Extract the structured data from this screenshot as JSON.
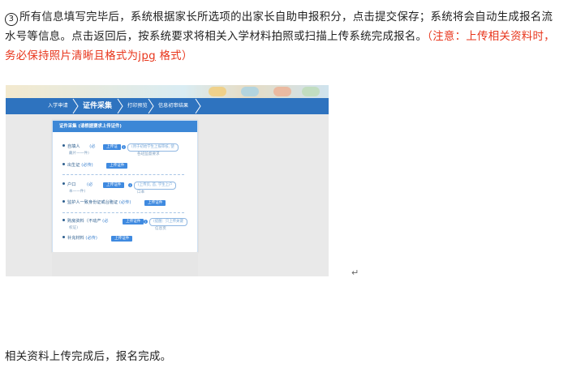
{
  "paragraph": {
    "step_marker": "3",
    "text_line1": "所有信息填写完毕后，系统根据家长所选项的出家长自助申报积分，点击提交保存；系统将会自动生成报名流",
    "text_line2": "水号等信息。点击返回后，按系统要求将相关入学材料拍照或扫描上传系统完成报名。",
    "note_part1": "（注意：上传相关资料时，",
    "note_part2": "务必保持照片清晰且格式为",
    "note_format": "jpg",
    "note_part3": " 格式）"
  },
  "screenshot": {
    "steps": [
      "入学申请",
      "证件采集",
      "打印预览",
      "信息初审结果"
    ],
    "panel_title": "证件采集 (请根据要求上传证件)",
    "items": [
      {
        "label": "自填人",
        "sub": "戴片一一件)",
        "required": "(必",
        "button": "上传证",
        "hint": "(用于初始学生上报审核, 使",
        "hint_sub": "各班监督要求"
      },
      {
        "label": "出生证",
        "required": "(必传)",
        "button": "上传证件"
      },
      {
        "label": "户口",
        "sub": "本一一件)",
        "required": "(必",
        "button": "上传证件",
        "hint": "(上传页, 首, 学生上户",
        "hint_sub": "口本"
      },
      {
        "label": "监护人一致身份证或台胞证",
        "required": "(必传)",
        "button": "上传证件"
      },
      {
        "label": "购房资料（不动产",
        "sub": "权证)",
        "required": "(必",
        "button": "上传证件",
        "hint": "(提醒：只上传关键",
        "hint_sub": "信息页"
      },
      {
        "label": "补充材料",
        "required": "(必传)",
        "button": "上传证件"
      }
    ]
  },
  "return_mark": "↵",
  "final_text": "相关资料上传完成后，报名完成。"
}
